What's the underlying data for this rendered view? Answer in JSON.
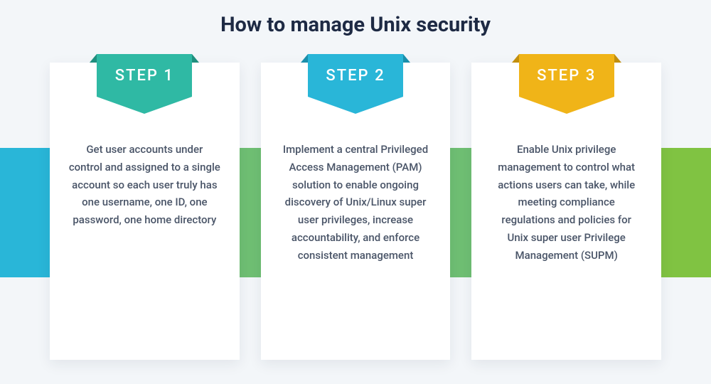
{
  "title": "How to manage Unix security",
  "band_colors": [
    "#29b6d8",
    "#6fbf73",
    "#6fbf73",
    "#80c342"
  ],
  "steps": [
    {
      "label": "STEP 1",
      "ribbon_color": "#2fb9a4",
      "ribbon_shade": "#1f8f7e",
      "text": "Get user accounts under control and assigned to a single account so each user truly has one username, one ID, one password, one home directory"
    },
    {
      "label": "STEP 2",
      "ribbon_color": "#29b6d8",
      "ribbon_shade": "#1a8fab",
      "text": "Implement a central Privileged Access Management (PAM) solution to enable ongoing discovery of Unix/Linux super user privileges, increase accountability, and enforce consistent management"
    },
    {
      "label": "STEP 3",
      "ribbon_color": "#f0b418",
      "ribbon_shade": "#c28f0e",
      "text": "Enable Unix privilege management to control what actions users can take, while meeting compliance regulations and policies for Unix super user Privilege Management (SUPM)"
    }
  ]
}
